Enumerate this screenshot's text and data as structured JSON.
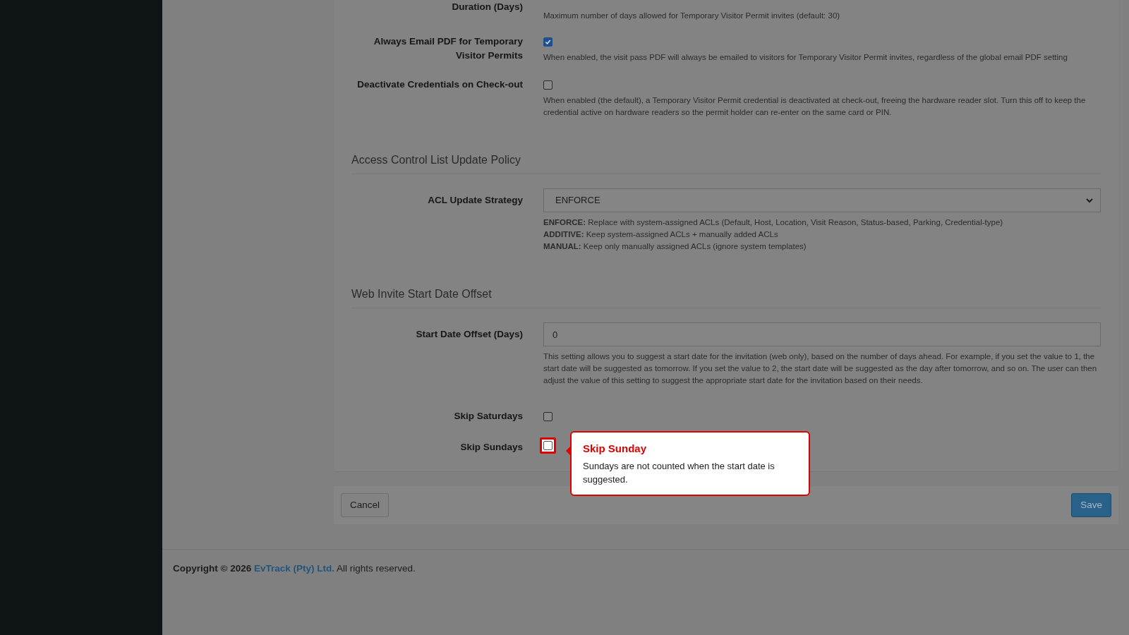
{
  "top_rows": [
    {
      "kind": "help_only",
      "label": "Duration (Days)",
      "help": "Maximum number of days allowed for Temporary Visitor Permit invites (default: 30)"
    },
    {
      "kind": "checkbox",
      "label": "Always Email PDF for Temporary Visitor Permits",
      "checked": true,
      "highlighted": false,
      "help": "When enabled, the visit pass PDF will always be emailed to visitors for Temporary Visitor Permit invites, regardless of the global email PDF setting"
    },
    {
      "kind": "checkbox",
      "label": "Deactivate Credentials on Check-out",
      "checked": false,
      "highlighted": false,
      "help": "When enabled (the default), a Temporary Visitor Permit credential is deactivated at check-out, freeing the hardware reader slot. Turn this off to keep the credential active on hardware readers so the permit holder can re-enter on the same card or PIN."
    }
  ],
  "sections": [
    {
      "heading": "Access Control List Update Policy",
      "rows": [
        {
          "kind": "select",
          "label": "ACL Update Strategy",
          "value": "ENFORCE",
          "help_lines": [
            "**ENFORCE:** Replace with system-assigned ACLs (Default, Host, Location, Visit Reason, Status-based, Parking, Credential-type)",
            "**ADDITIVE:** Keep system-assigned ACLs + manually added ACLs",
            "**MANUAL:** Keep only manually assigned ACLs (ignore system templates)"
          ]
        }
      ]
    },
    {
      "heading": "Web Invite Start Date Offset",
      "rows": [
        {
          "kind": "number",
          "label": "Start Date Offset (Days)",
          "value": "0",
          "help": "This setting allows you to suggest a start date for the invitation (web only), based on the number of days ahead. For example, if you set the value to 1, the start date will be suggested as tomorrow. If you set the value to 2, the start date will be suggested as the day after tomorrow, and so on. The user can then adjust the value of this setting to suggest the appropriate start date for the invitation based on their needs."
        },
        {
          "kind": "checkbox",
          "label": "Skip Saturdays",
          "checked": false,
          "highlighted": false
        },
        {
          "kind": "checkbox",
          "label": "Skip Sundays",
          "checked": false,
          "highlighted": true
        }
      ]
    }
  ],
  "tooltip": {
    "title": "Skip Sunday",
    "body": "Sundays are not counted when the start date is suggested."
  },
  "actions": [
    {
      "kind": "secondary",
      "label": "Cancel"
    },
    {
      "kind": "primary",
      "label": "Save"
    }
  ],
  "footer": {
    "prefix": "Copyright © 2026",
    "link": "EvTrack (Pty) Ltd.",
    "suffix": "All rights reserved."
  }
}
